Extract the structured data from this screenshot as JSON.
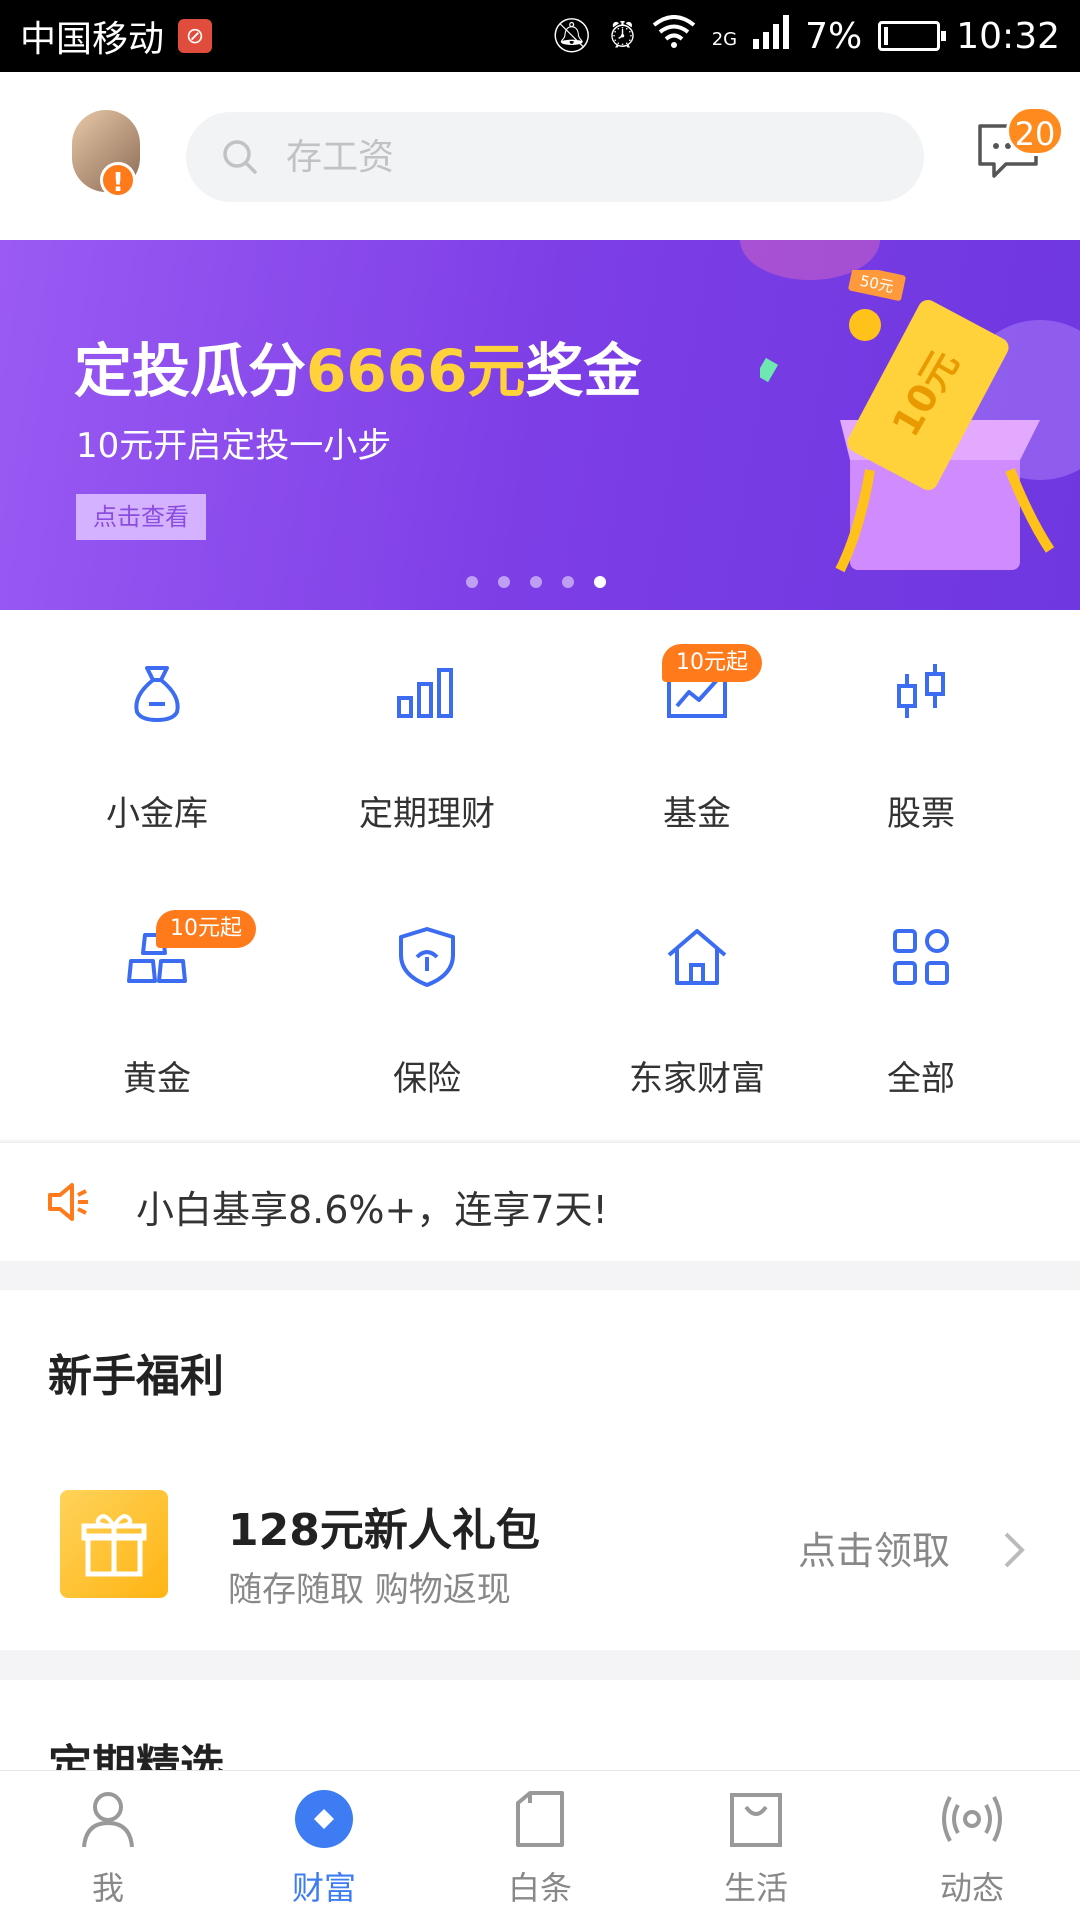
{
  "status_bar": {
    "carrier": "中国移动",
    "network": "2G",
    "battery_percent": "7%",
    "time": "10:32"
  },
  "header": {
    "search_placeholder": "存工资",
    "message_badge": "20"
  },
  "banner": {
    "title_prefix": "定投瓜分",
    "title_highlight": "6666元",
    "title_suffix": "奖金",
    "subtitle": "10元开启定投一小步",
    "cta": "点击查看",
    "ticket_small": "50元",
    "ticket_big": "10元",
    "dots_total": 5,
    "dots_active_index": 4
  },
  "grid": [
    {
      "label": "小金库",
      "icon": "money-bag-icon",
      "tag": ""
    },
    {
      "label": "定期理财",
      "icon": "bar-chart-icon",
      "tag": ""
    },
    {
      "label": "基金",
      "icon": "trend-chart-icon",
      "tag": "10元起"
    },
    {
      "label": "股票",
      "icon": "candlestick-icon",
      "tag": ""
    },
    {
      "label": "黄金",
      "icon": "gold-bars-icon",
      "tag": "10元起"
    },
    {
      "label": "保险",
      "icon": "shield-icon",
      "tag": ""
    },
    {
      "label": "东家财富",
      "icon": "house-icon",
      "tag": ""
    },
    {
      "label": "全部",
      "icon": "grid-icon",
      "tag": ""
    }
  ],
  "notice": {
    "text": "小白基享8.6%+，连享7天!"
  },
  "newbie": {
    "title": "新手福利",
    "item_title": "128元新人礼包",
    "item_sub": "随存随取 购物返现",
    "item_cta": "点击领取"
  },
  "fixed_section": {
    "title": "定期精选"
  },
  "tabs": [
    {
      "label": "我",
      "icon": "person-icon",
      "active": false
    },
    {
      "label": "财富",
      "icon": "wealth-icon",
      "active": true
    },
    {
      "label": "白条",
      "icon": "card-icon",
      "active": false
    },
    {
      "label": "生活",
      "icon": "shopping-bag-icon",
      "active": false
    },
    {
      "label": "动态",
      "icon": "broadcast-icon",
      "active": false
    }
  ],
  "colors": {
    "accent_blue": "#3d7cf3",
    "orange": "#ff7a1a",
    "banner_purple": "#7d3ee6",
    "highlight_yellow": "#ffd23c"
  }
}
